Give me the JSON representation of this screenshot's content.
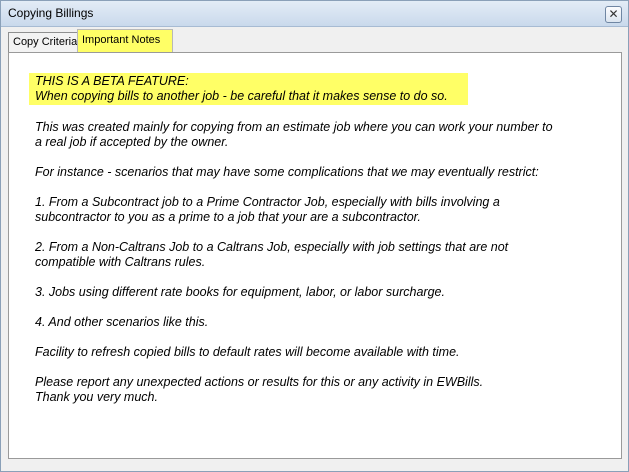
{
  "window": {
    "title": "Copying Billings",
    "close_glyph": "✕"
  },
  "tabs": [
    {
      "label": "Copy Criteria",
      "active": false
    },
    {
      "label": "Important Notes",
      "active": true
    }
  ],
  "notes": {
    "beta_line1": "THIS IS A BETA FEATURE:",
    "beta_line2": "When copying bills to another job - be careful that it makes sense to do so.",
    "para1_line1": "This was created mainly for copying from an estimate job where you can work your number to",
    "para1_line2": "a real job if accepted by the owner.",
    "para2": "For instance - scenarios that may have some complications that we may eventually restrict:",
    "item1_line1": "1. From a Subcontract job to a Prime Contractor Job, especially with bills involving a",
    "item1_line2": "subcontractor to you as a prime to a job that your are a subcontractor.",
    "item2_line1": "2. From a Non-Caltrans Job to a Caltrans Job, especially with job settings that are not",
    "item2_line2": "compatible with Caltrans rules.",
    "item3": "3. Jobs using different rate books for equipment, labor, or labor surcharge.",
    "item4": "4. And other scenarios like this.",
    "refresh": "Facility to refresh copied bills to default rates will become available with time.",
    "report_line1": "Please report any unexpected actions or results for this or any activity in EWBills.",
    "report_line2": "Thank you very much."
  },
  "colors": {
    "highlight": "#ffff66",
    "panel_bg": "#ffffff",
    "window_bg": "#f0f0f0"
  }
}
